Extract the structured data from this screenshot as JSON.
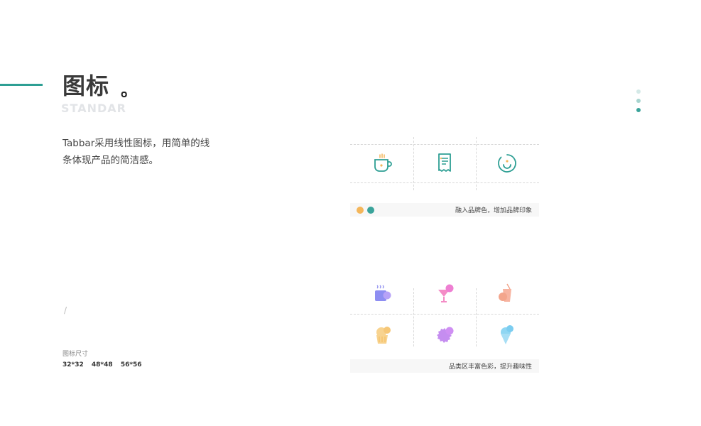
{
  "header": {
    "title": "图标",
    "title_dot": "。",
    "subtitle": "STANDAR"
  },
  "intro": "Tabbar采用线性图标，用简单的线条体现产品的简洁感。",
  "pager": {
    "count": 3,
    "active_index": 2
  },
  "slash_mark": "/",
  "icon_sizes": {
    "label": "图标尺寸",
    "values": [
      "32*32",
      "48*48",
      "56*56"
    ]
  },
  "line_icons": {
    "caption": "融入品牌色，增加品牌印象",
    "brand_colors": [
      "#f4b65a",
      "#3aa39a"
    ],
    "icons": [
      "coffee-cup-icon",
      "receipt-icon",
      "smile-face-icon"
    ]
  },
  "color_icons": {
    "caption": "品类区丰富色彩，提升趣味性",
    "icons": [
      "hot-mug-icon",
      "cocktail-icon",
      "drink-cup-icon",
      "cupcake-icon",
      "cookie-icon",
      "ice-cream-icon"
    ]
  },
  "colors": {
    "accent": "#2e9f94",
    "pager_active": "#3aa39a",
    "pager_mid": "#a7d4cf",
    "pager_light": "#d4e9e7"
  }
}
